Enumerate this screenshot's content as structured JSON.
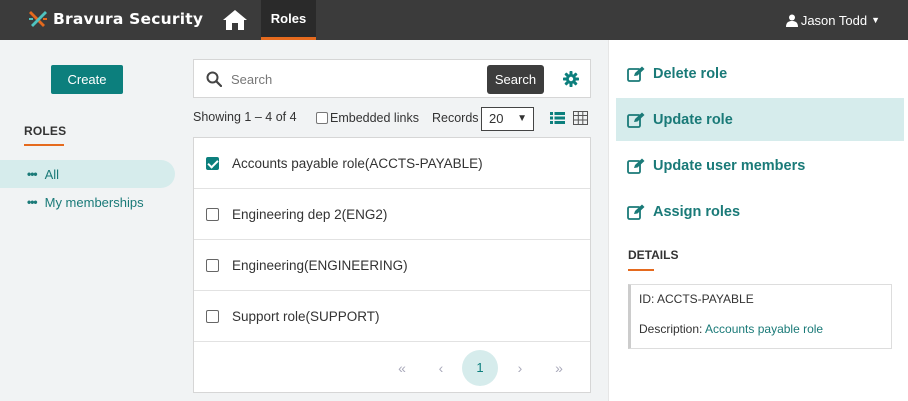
{
  "header": {
    "app_name": "Bravura Security",
    "nav_tab": "Roles",
    "user_name": "Jason Todd"
  },
  "sidebar": {
    "create_label": "Create",
    "heading": "ROLES",
    "items": [
      {
        "label": "All",
        "active": true
      },
      {
        "label": "My memberships",
        "active": false
      }
    ]
  },
  "search": {
    "placeholder": "Search",
    "value": "",
    "button_label": "Search"
  },
  "list_controls": {
    "showing": "Showing 1 – 4 of 4",
    "embedded_links_label": "Embedded links",
    "embedded_links_checked": false,
    "records_label": "Records",
    "records_value": "20"
  },
  "rows": [
    {
      "label": "Accounts payable role(ACCTS-PAYABLE)",
      "checked": true
    },
    {
      "label": "Engineering dep 2(ENG2)",
      "checked": false
    },
    {
      "label": "Engineering(ENGINEERING)",
      "checked": false
    },
    {
      "label": "Support role(SUPPORT)",
      "checked": false
    }
  ],
  "pager": {
    "first": "«",
    "prev": "‹",
    "current": "1",
    "next": "›",
    "last": "»"
  },
  "actions": [
    {
      "label": "Delete role",
      "active": false
    },
    {
      "label": "Update role",
      "active": true
    },
    {
      "label": "Update user members",
      "active": false
    },
    {
      "label": "Assign roles",
      "active": false
    }
  ],
  "details": {
    "heading": "DETAILS",
    "id_label": "ID:",
    "id_value": "ACCTS-PAYABLE",
    "description_label": "Description:",
    "description_value": "Accounts payable role"
  },
  "colors": {
    "accent_teal": "#0c7f7d",
    "accent_orange": "#e56a1e",
    "topbar": "#3b3b3b",
    "highlight": "#d6ecec"
  }
}
